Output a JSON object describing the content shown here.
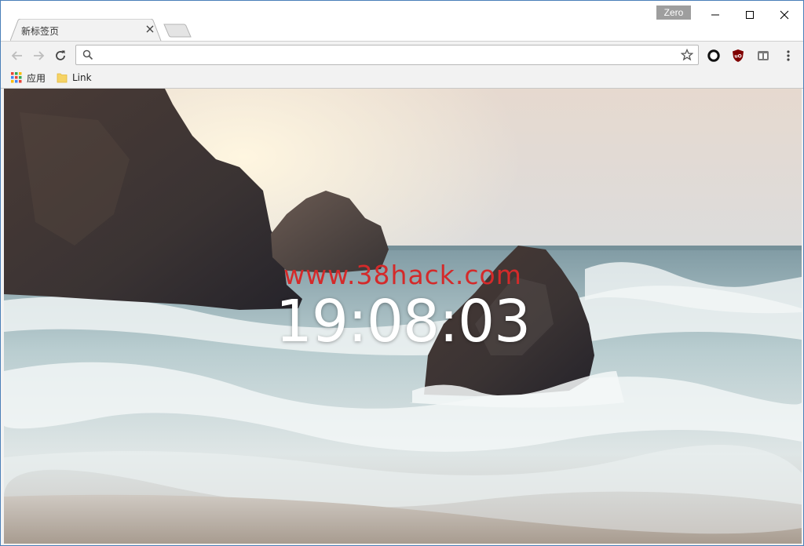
{
  "window": {
    "profile_name": "Zero"
  },
  "tabs": [
    {
      "title": "新标签页",
      "active": true
    }
  ],
  "omnibox": {
    "value": "",
    "placeholder": ""
  },
  "toolbar": {
    "icons": [
      "back-icon",
      "forward-icon",
      "reload-icon",
      "search-icon",
      "bookmark-star-icon"
    ],
    "extensions": [
      "circle-extension-icon",
      "ublock-icon",
      "tab-manager-icon",
      "menu-icon"
    ]
  },
  "bookmarks": {
    "apps_label": "应用",
    "link_label": "Link"
  },
  "newtab": {
    "watermark": "www.38hack.com",
    "clock": "19:08:03"
  },
  "colors": {
    "watermark": "#d42a2a",
    "clock": "#ffffff",
    "window_border": "#4a7fb8"
  }
}
